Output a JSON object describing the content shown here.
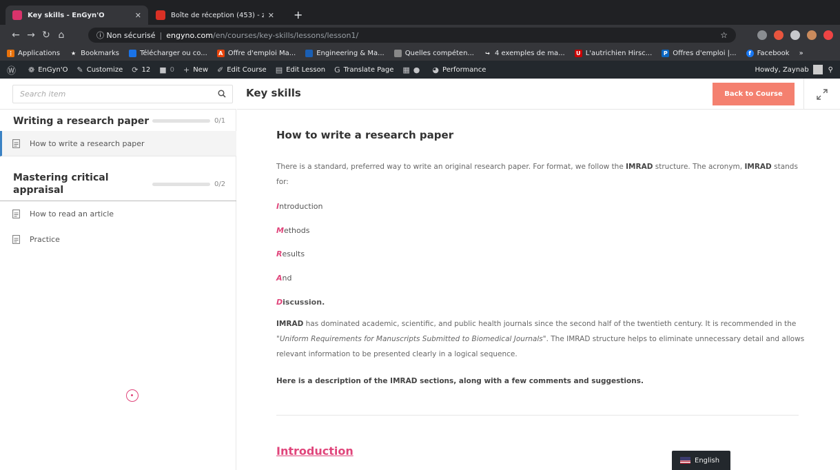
{
  "browser": {
    "tabs": [
      {
        "title": "Key skills - EnGyn'O",
        "active": true
      },
      {
        "title": "Boîte de réception (453) - zay",
        "active": false
      }
    ],
    "url_security": "Non sécurisé",
    "url_host": "engyno.com",
    "url_path": "/en/courses/key-skills/lessons/lesson1/",
    "bookmarks": [
      "Applications",
      "Bookmarks",
      "Télécharger ou co...",
      "Offre d'emploi Ma...",
      "Engineering & Ma...",
      "Quelles compéten...",
      "4 exemples de ma...",
      "L'autrichien Hirsc...",
      "Offres d'emploi |...",
      "Facebook"
    ]
  },
  "wp_admin": {
    "site": "EnGyn'O",
    "customize": "Customize",
    "updates": "12",
    "comments": "0",
    "new": "New",
    "edit_course": "Edit Course",
    "edit_lesson": "Edit Lesson",
    "translate": "Translate Page",
    "performance": "Performance",
    "howdy": "Howdy, Zaynab"
  },
  "sidebar": {
    "search_placeholder": "Search item",
    "sections": [
      {
        "title": "Writing a research paper",
        "count": "0/1",
        "progress": 0,
        "lessons": [
          "How to write a research paper"
        ]
      },
      {
        "title": "Mastering critical appraisal",
        "count": "0/2",
        "progress": 0,
        "lessons": [
          "How to read an article",
          "Practice"
        ]
      }
    ]
  },
  "header": {
    "course_title": "Key skills",
    "back_button": "Back to Course"
  },
  "lesson": {
    "heading": "How to write a research paper",
    "intro_p1": "There is a standard, preferred way to write an original research paper. For format, we follow the ",
    "intro_imrad": "IMRAD",
    "intro_p2": " structure. The acronym, ",
    "intro_imrad2": "IMRAD",
    "intro_p3": " stands for:",
    "imrad_letters": [
      {
        "letter": "I",
        "rest": "ntroduction"
      },
      {
        "letter": "M",
        "rest": "ethods"
      },
      {
        "letter": "R",
        "rest": "esults"
      },
      {
        "letter": "A",
        "rest": "nd"
      },
      {
        "letter": "D",
        "rest": "iscussion."
      }
    ],
    "body_p1": " has dominated academic, scientific, and public health journals since the second half of the twentieth century. It is recommended in the \"",
    "body_imrad": "IMRAD",
    "body_ref": "Uniform Requirements for Manuscripts Submitted to Biomedical Journals",
    "body_p2": "\". The IMRAD structure helps to eliminate unnecessary detail and allows relevant information to be presented clearly in a logical sequence.",
    "description_line": "Here is a description of the IMRAD sections, along with a few comments and suggestions.",
    "section_heading": "Introduction"
  },
  "language": "English"
}
